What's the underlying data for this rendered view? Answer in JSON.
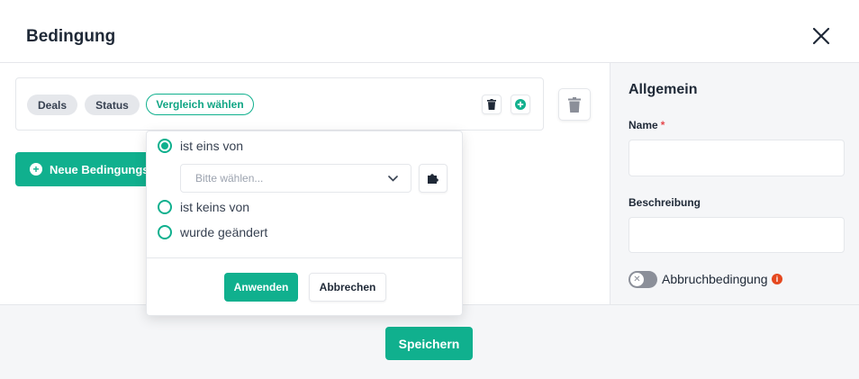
{
  "header": {
    "title": "Bedingung"
  },
  "condition": {
    "chips": [
      "Deals",
      "Status"
    ],
    "compare_label": "Vergleich wählen"
  },
  "new_condition_label": "Neue Bedingungs",
  "popover": {
    "options": [
      {
        "label": "ist eins von",
        "checked": true
      },
      {
        "label": "ist keins von",
        "checked": false
      },
      {
        "label": "wurde geändert",
        "checked": false
      }
    ],
    "select_placeholder": "Bitte wählen...",
    "apply_label": "Anwenden",
    "cancel_label": "Abbrechen"
  },
  "sidebar": {
    "heading": "Allgemein",
    "name_label": "Name",
    "name_required_mark": "*",
    "name_value": "",
    "description_label": "Beschreibung",
    "description_value": "",
    "abort_label": "Abbruchbedingung",
    "abort_enabled": false,
    "info_glyph": "i"
  },
  "footer": {
    "save_label": "Speichern"
  },
  "colors": {
    "accent": "#10b08e",
    "required": "#e5484d",
    "info": "#e5481f"
  },
  "icons": {
    "close": "close-icon",
    "trash": "trash-icon",
    "add": "plus-circle-icon",
    "chevron": "chevron-down-icon",
    "puzzle": "puzzle-icon",
    "info": "info-icon"
  }
}
